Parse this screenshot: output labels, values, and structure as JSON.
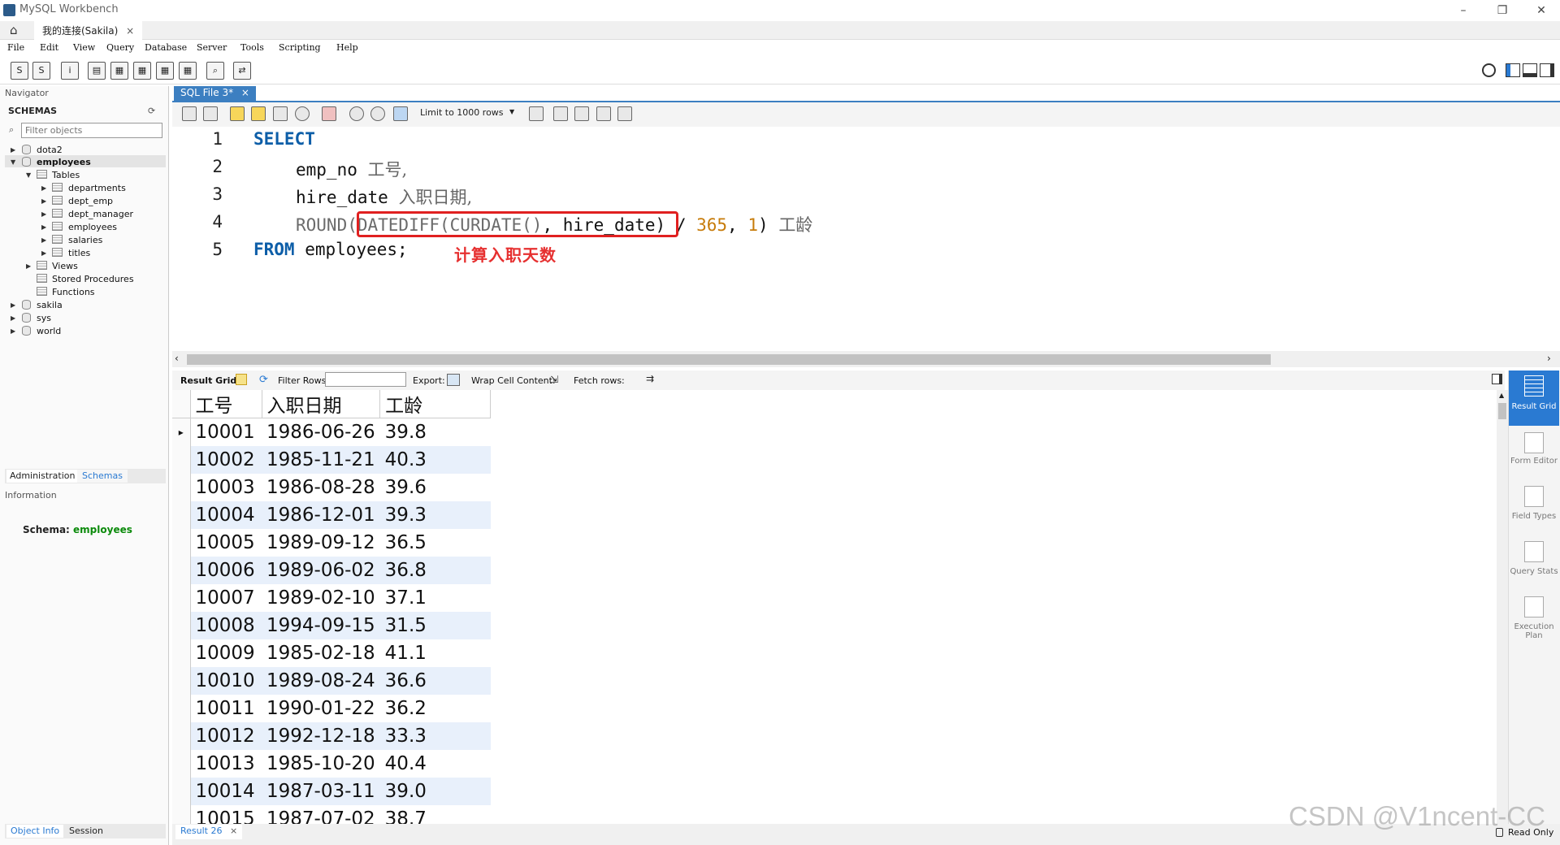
{
  "window": {
    "title": "MySQL Workbench",
    "controls": {
      "minimize": "–",
      "maximize": "❐",
      "close": "✕"
    }
  },
  "connection_tab": {
    "label": "我的连接(Sakila)",
    "close": "×"
  },
  "menu": [
    "File",
    "Edit",
    "View",
    "Query",
    "Database",
    "Server",
    "Tools",
    "Scripting",
    "Help"
  ],
  "navigator": {
    "header": "Navigator",
    "schemas_label": "SCHEMAS",
    "filter_placeholder": "Filter objects",
    "tree": {
      "dota2": "dota2",
      "employees": "employees",
      "tables": "Tables",
      "table_items": [
        "departments",
        "dept_emp",
        "dept_manager",
        "employees",
        "salaries",
        "titles"
      ],
      "views": "Views",
      "stored_procedures": "Stored Procedures",
      "functions": "Functions",
      "sakila": "sakila",
      "sys": "sys",
      "world": "world"
    },
    "tabs": {
      "administration": "Administration",
      "schemas": "Schemas"
    },
    "information_header": "Information",
    "schema_label": "Schema:",
    "schema_value": "employees",
    "bottom_tabs": {
      "object_info": "Object Info",
      "session": "Session"
    }
  },
  "editor": {
    "tab_label": "SQL File 3*",
    "tab_close": "×",
    "limit": "Limit to 1000 rows",
    "line_numbers": [
      "1",
      "2",
      "3",
      "4",
      "5"
    ],
    "lines": {
      "l1_select": "SELECT",
      "l2_col": "emp_no",
      "l2_alias": "工号,",
      "l3_col": "hire_date",
      "l3_alias": "入职日期,",
      "l4_round": "ROUND(",
      "l4_datediff": "DATEDIFF(",
      "l4_curdate": "CURDATE()",
      "l4_rest": ", hire_date)",
      "l4_div": " / ",
      "l4_365": "365",
      "l4_comma": ", ",
      "l4_one": "1",
      "l4_close": ")",
      "l4_alias": "工龄",
      "l5_from": "FROM",
      "l5_table": "employees;"
    },
    "annotation": "计算入职天数"
  },
  "result_toolbar": {
    "result_grid": "Result Grid",
    "filter_rows": "Filter Rows:",
    "export": "Export:",
    "wrap": "Wrap Cell Content:",
    "fetch": "Fetch rows:"
  },
  "result": {
    "columns": [
      "工号",
      "入职日期",
      "工龄"
    ],
    "rows": [
      [
        "10001",
        "1986-06-26",
        "39.8"
      ],
      [
        "10002",
        "1985-11-21",
        "40.3"
      ],
      [
        "10003",
        "1986-08-28",
        "39.6"
      ],
      [
        "10004",
        "1986-12-01",
        "39.3"
      ],
      [
        "10005",
        "1989-09-12",
        "36.5"
      ],
      [
        "10006",
        "1989-06-02",
        "36.8"
      ],
      [
        "10007",
        "1989-02-10",
        "37.1"
      ],
      [
        "10008",
        "1994-09-15",
        "31.5"
      ],
      [
        "10009",
        "1985-02-18",
        "41.1"
      ],
      [
        "10010",
        "1989-08-24",
        "36.6"
      ],
      [
        "10011",
        "1990-01-22",
        "36.2"
      ],
      [
        "10012",
        "1992-12-18",
        "33.3"
      ],
      [
        "10013",
        "1985-10-20",
        "40.4"
      ],
      [
        "10014",
        "1987-03-11",
        "39.0"
      ],
      [
        "10015",
        "1987-07-02",
        "38.7"
      ]
    ]
  },
  "right_panel": {
    "result_grid": "Result Grid",
    "form_editor": "Form Editor",
    "field_types": "Field Types",
    "query_stats": "Query Stats",
    "execution_plan": "Execution Plan"
  },
  "bottom": {
    "result_tab": "Result 26",
    "result_tab_close": "×",
    "read_only": "Read Only"
  },
  "watermark": "CSDN @V1ncent-CC",
  "colors": {
    "accent": "#2a7ad2",
    "keyword": "#0d5ea8",
    "highlight": "#e02020",
    "alt_row": "#e8f0fb"
  }
}
